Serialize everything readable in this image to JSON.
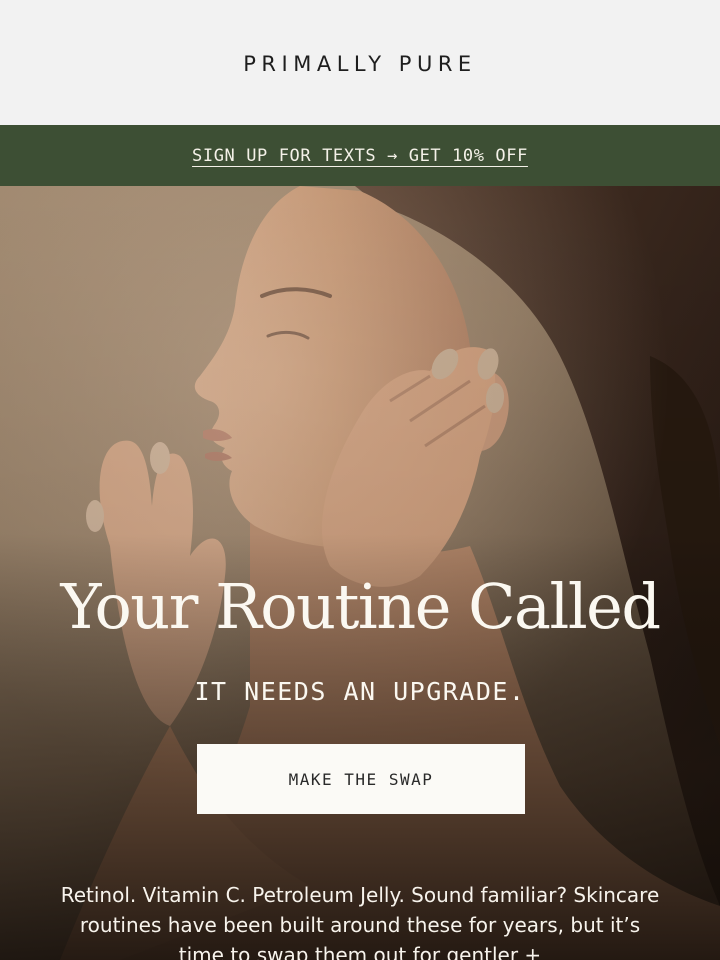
{
  "header": {
    "brand": "PRIMALLY PURE"
  },
  "promo_bar": {
    "link_text": "SIGN UP FOR TEXTS → GET 10% OFF"
  },
  "hero": {
    "title": "Your Routine Called",
    "subtitle": "IT NEEDS AN UPGRADE.",
    "cta_label": "MAKE THE SWAP"
  },
  "body": {
    "intro_partial": "Retinol. Vitamin C. Petroleum Jelly. Sound familiar? Skincare routines have been built around these for years, but it’s time to swap them out for gentler +"
  },
  "colors": {
    "header_bg": "#f2f2f2",
    "promo_bg": "#3d4f34",
    "promo_text": "#f4f1e8",
    "hero_text": "#fbf8f1",
    "cta_bg": "#fbfaf6"
  }
}
